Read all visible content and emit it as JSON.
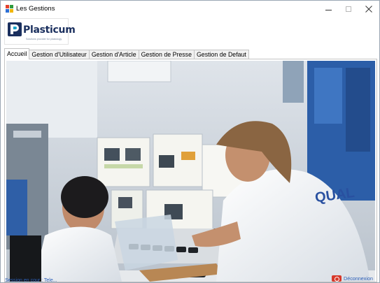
{
  "window": {
    "title": "Les Gestions",
    "icon": "app-window-icon",
    "controls": {
      "minimize": "minimize-icon",
      "maximize": "maximize-icon",
      "close": "close-icon"
    }
  },
  "logo": {
    "brand_prefix": "Pl",
    "brand_mid": "asti",
    "brand_suffix": "cum",
    "tagline": "Solutions provider for plastology",
    "colors": {
      "primary": "#1a2f5e",
      "accent": "#18a2c9"
    }
  },
  "tabs": [
    {
      "label": "Accueil",
      "active": true
    },
    {
      "label": "Gestion  d'Utilisateur",
      "active": false
    },
    {
      "label": "Gestion d'Article",
      "active": false
    },
    {
      "label": "Gestion de Presse",
      "active": false
    },
    {
      "label": "Gestion de Defaut",
      "active": false
    }
  ],
  "main_image": {
    "alt": "Photo: two workers in white coats inspecting black plastic parts in a factory",
    "coat_text": "QUAL"
  },
  "footer": {
    "session_text": "Session en cour : Tele...",
    "logout_label": "Déconnexion",
    "logout_icon": "logout-icon",
    "link_color": "#2c5fb8"
  }
}
